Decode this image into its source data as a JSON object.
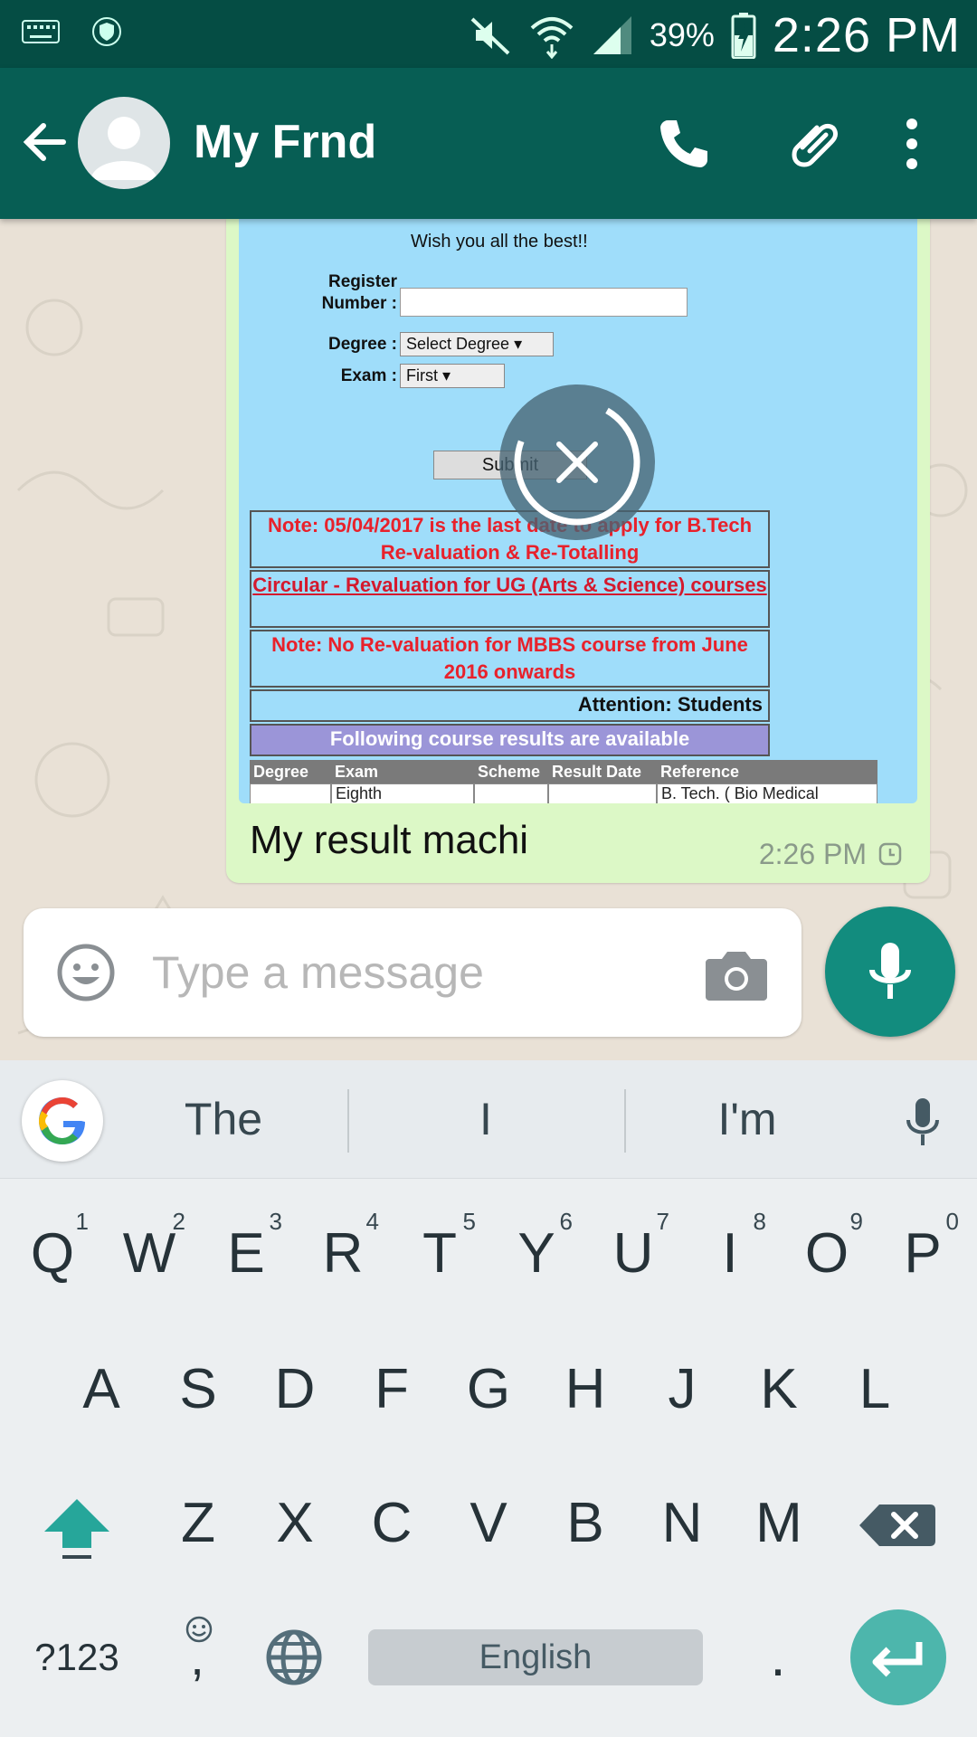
{
  "status_bar": {
    "battery": "39%",
    "time": "2:26 PM",
    "icons": [
      "keyboard-icon",
      "vpn-shield-icon",
      "mute-icon",
      "wifi-icon",
      "signal-icon",
      "battery-charging-icon"
    ]
  },
  "header": {
    "contact_name": "My Frnd",
    "icons": [
      "back-arrow-icon",
      "avatar",
      "call-icon",
      "attach-icon",
      "more-vert-icon"
    ]
  },
  "message": {
    "image_text": {
      "wish": "Wish you all the best!!",
      "register_label": "Register Number :",
      "degree_label": "Degree :",
      "degree_select": "Select Degree",
      "exam_label": "Exam :",
      "exam_select": "First",
      "submit": "Submit",
      "note1": "Note: 05/04/2017 is the last date to apply for B.Tech Re-valuation & Re-Totalling",
      "circular": "Circular - Revaluation for UG (Arts & Science) courses",
      "note2": "Note: No Re-valuation for MBBS course from June 2016 onwards",
      "attention": "Attention: Students",
      "available": "Following course results are available",
      "table_headers": [
        "Degree",
        "Exam",
        "Scheme",
        "Result Date",
        "Reference"
      ],
      "table_row": [
        "",
        "Eighth",
        "",
        "",
        "B. Tech. ( Bio Medical"
      ]
    },
    "caption": "My result machi",
    "time": "2:26 PM"
  },
  "composer": {
    "placeholder": "Type a message"
  },
  "keyboard": {
    "suggestions": [
      "The",
      "I",
      "I'm"
    ],
    "row1": [
      {
        "k": "Q",
        "n": "1"
      },
      {
        "k": "W",
        "n": "2"
      },
      {
        "k": "E",
        "n": "3"
      },
      {
        "k": "R",
        "n": "4"
      },
      {
        "k": "T",
        "n": "5"
      },
      {
        "k": "Y",
        "n": "6"
      },
      {
        "k": "U",
        "n": "7"
      },
      {
        "k": "I",
        "n": "8"
      },
      {
        "k": "O",
        "n": "9"
      },
      {
        "k": "P",
        "n": "0"
      }
    ],
    "row2": [
      "A",
      "S",
      "D",
      "F",
      "G",
      "H",
      "J",
      "K",
      "L"
    ],
    "row3": [
      "Z",
      "X",
      "C",
      "V",
      "B",
      "N",
      "M"
    ],
    "symbols": "?123",
    "comma": ",",
    "space": "English",
    "period": "."
  },
  "colors": {
    "status_bar": "#054d44",
    "app_bar": "#075e54",
    "bubble": "#dcf8c6",
    "mic_button": "#128c7e",
    "enter_key": "#4db6ac"
  }
}
